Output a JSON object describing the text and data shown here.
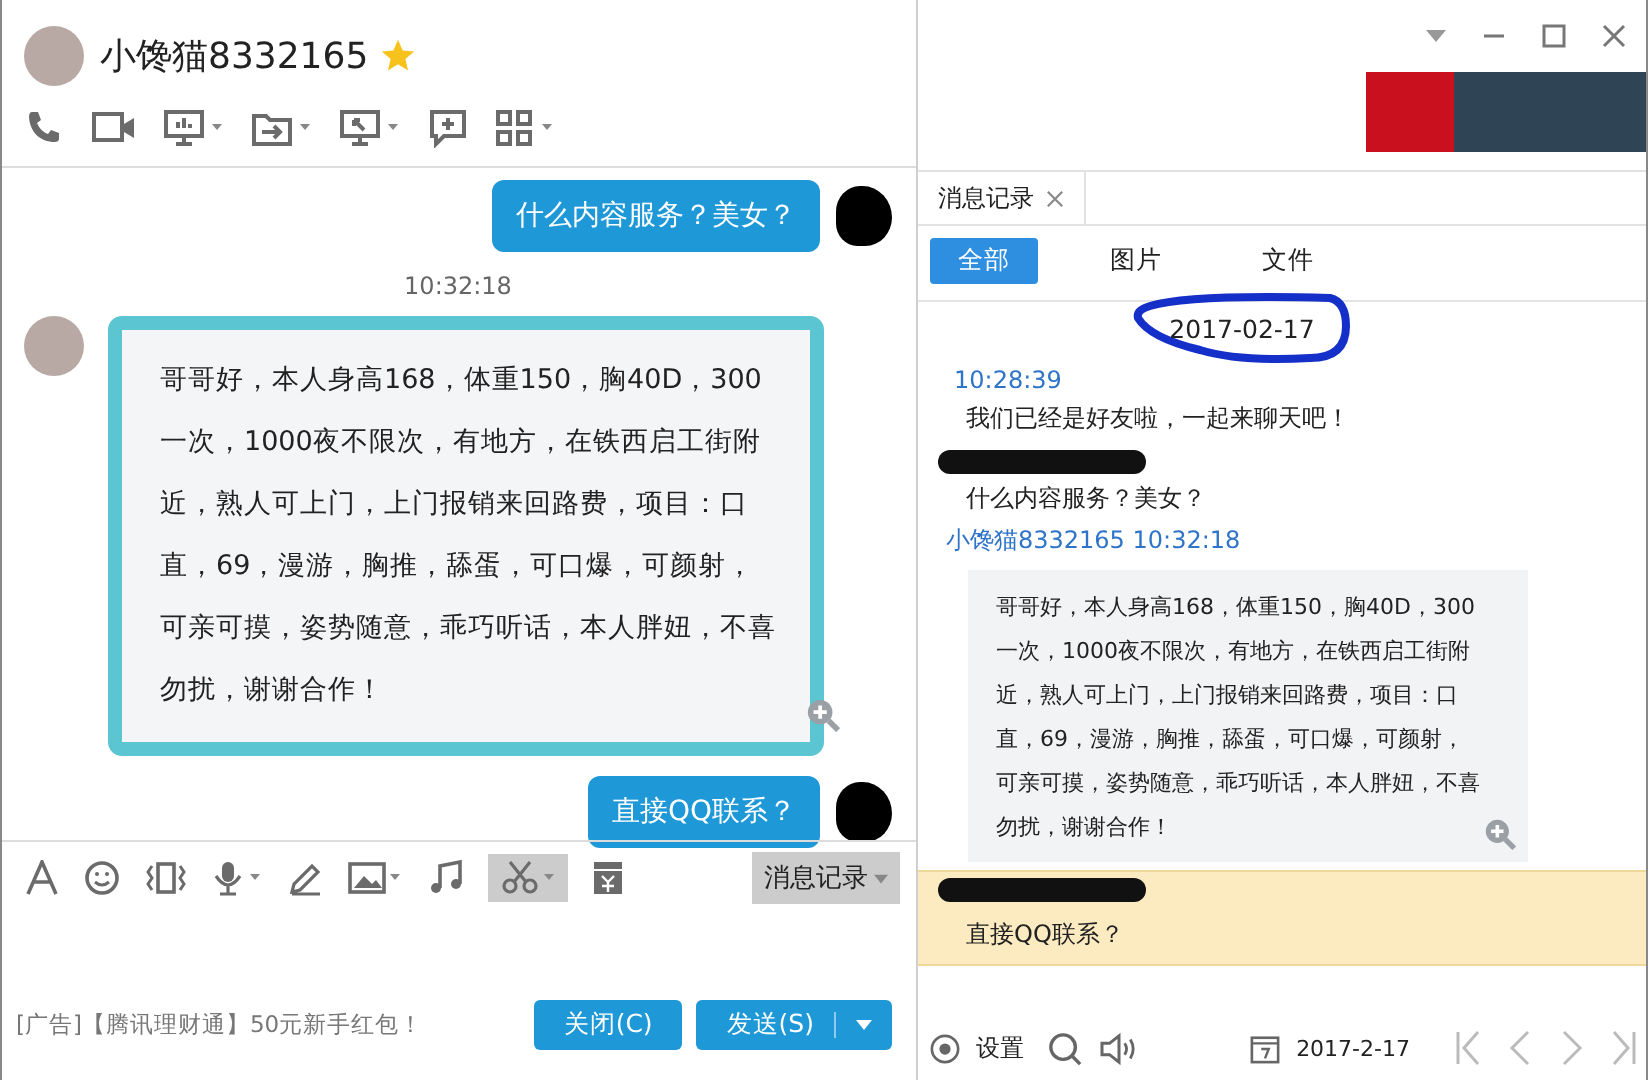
{
  "window": {
    "title": "小馋猫8332165"
  },
  "chat": {
    "messages": [
      {
        "kind": "outgoing",
        "text": "什么内容服务？美女？"
      },
      {
        "kind": "time",
        "text": "10:32:18"
      },
      {
        "kind": "incoming",
        "text": "哥哥好，本人身高168，体重150，胸40D，300一次，1000夜不限次，有地方，在铁西启工街附近，熟人可上门，上门报销来回路费，项目：口直，69，漫游，胸推，舔蛋，可口爆，可颜射，可亲可摸，姿势随意，乖巧听话，本人胖妞，不喜勿扰，谢谢合作！"
      },
      {
        "kind": "outgoing",
        "text": "直接QQ联系？"
      }
    ]
  },
  "input_toolbar": {
    "history_button": "消息记录"
  },
  "ad_text": "[广告]【腾讯理财通】50元新手红包！",
  "buttons": {
    "close": "关闭(C)",
    "send": "发送(S)"
  },
  "history": {
    "tab": "消息记录",
    "filters": [
      {
        "label": "全部",
        "selected": true
      },
      {
        "label": "图片",
        "selected": false
      },
      {
        "label": "文件",
        "selected": false
      }
    ],
    "date": "2017-02-17",
    "entries": [
      {
        "kind": "system",
        "time": "10:28:39",
        "text": "我们已经是好友啦，一起来聊天吧！"
      },
      {
        "kind": "self",
        "text": "什么内容服务？美女？",
        "highlighted": false
      },
      {
        "kind": "peer",
        "header": "小馋猫8332165 10:32:18",
        "text": "哥哥好，本人身高168，体重150，胸40D，300一次，1000夜不限次，有地方，在铁西启工街附近，熟人可上门，上门报销来回路费，项目：口直，69，漫游，胸推，舔蛋，可口爆，可颜射，可亲可摸，姿势随意，乖巧听话，本人胖妞，不喜勿扰，谢谢合作！"
      },
      {
        "kind": "self",
        "text": "直接QQ联系？",
        "highlighted": true
      }
    ],
    "settings_label": "设置",
    "date_field": "2017-2-17"
  }
}
